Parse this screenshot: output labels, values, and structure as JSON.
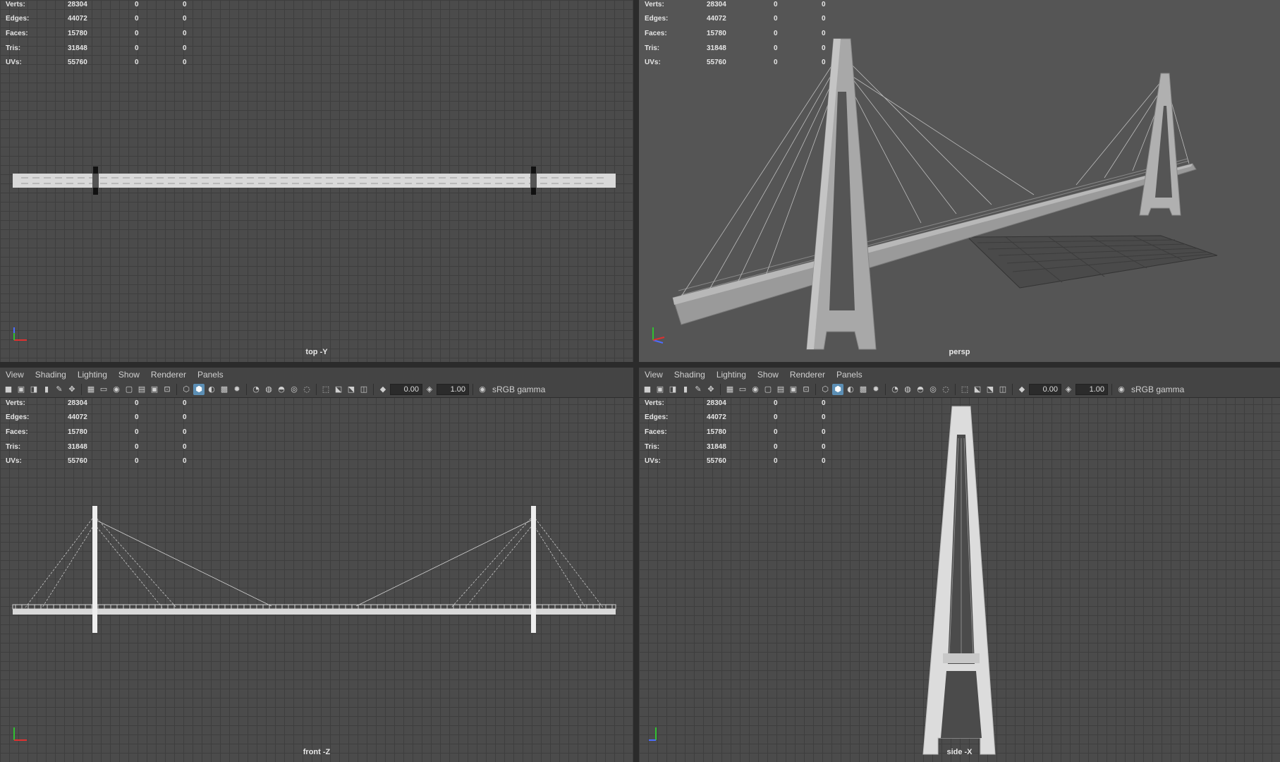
{
  "menu": [
    "View",
    "Shading",
    "Lighting",
    "Show",
    "Renderer",
    "Panels"
  ],
  "toolbar": {
    "exposure": "0.00",
    "gamma_value": "1.00",
    "color_space": "sRGB gamma"
  },
  "hud": {
    "rows": [
      {
        "label": "Verts:",
        "value": "28304",
        "sel": "0",
        "tri": "0"
      },
      {
        "label": "Edges:",
        "value": "44072",
        "sel": "0",
        "tri": "0"
      },
      {
        "label": "Faces:",
        "value": "15780",
        "sel": "0",
        "tri": "0"
      },
      {
        "label": "Tris:",
        "value": "31848",
        "sel": "0",
        "tri": "0"
      },
      {
        "label": "UVs:",
        "value": "55760",
        "sel": "0",
        "tri": "0"
      }
    ]
  },
  "viewports": {
    "top": {
      "label": "top -Y"
    },
    "persp": {
      "label": "persp"
    },
    "front": {
      "label": "front -Z"
    },
    "side": {
      "label": "side -X"
    }
  },
  "colors": {
    "grid_bg": "#4b4b4b",
    "grid_line": "#3e3e3e",
    "persp_bg": "#555555",
    "model": "#d9d9d9",
    "active_icon": "#5c8fb5"
  },
  "toolbar_icons": [
    "camera-icon",
    "camera-attr-icon",
    "bookmark-icon",
    "image-plane-icon",
    "grease-pencil-icon",
    "2d-pan-icon",
    "grid-icon",
    "film-gate-icon",
    "resolution-gate-icon",
    "gate-mask-icon",
    "field-chart-icon",
    "safe-action-icon",
    "safe-title-icon",
    "wireframe-icon",
    "smooth-shade-icon",
    "wire-on-shaded-icon",
    "textured-icon",
    "use-all-lights-icon",
    "shadows-icon",
    "screen-ambient-occlusion-icon",
    "motion-blur-icon",
    "multisample-aa-icon",
    "depth-of-field-icon",
    "isolate-select-icon",
    "xray-icon",
    "xray-joints-icon",
    "backface-culling-icon",
    "exposure-icon",
    "gamma-icon",
    "color-management-icon"
  ]
}
